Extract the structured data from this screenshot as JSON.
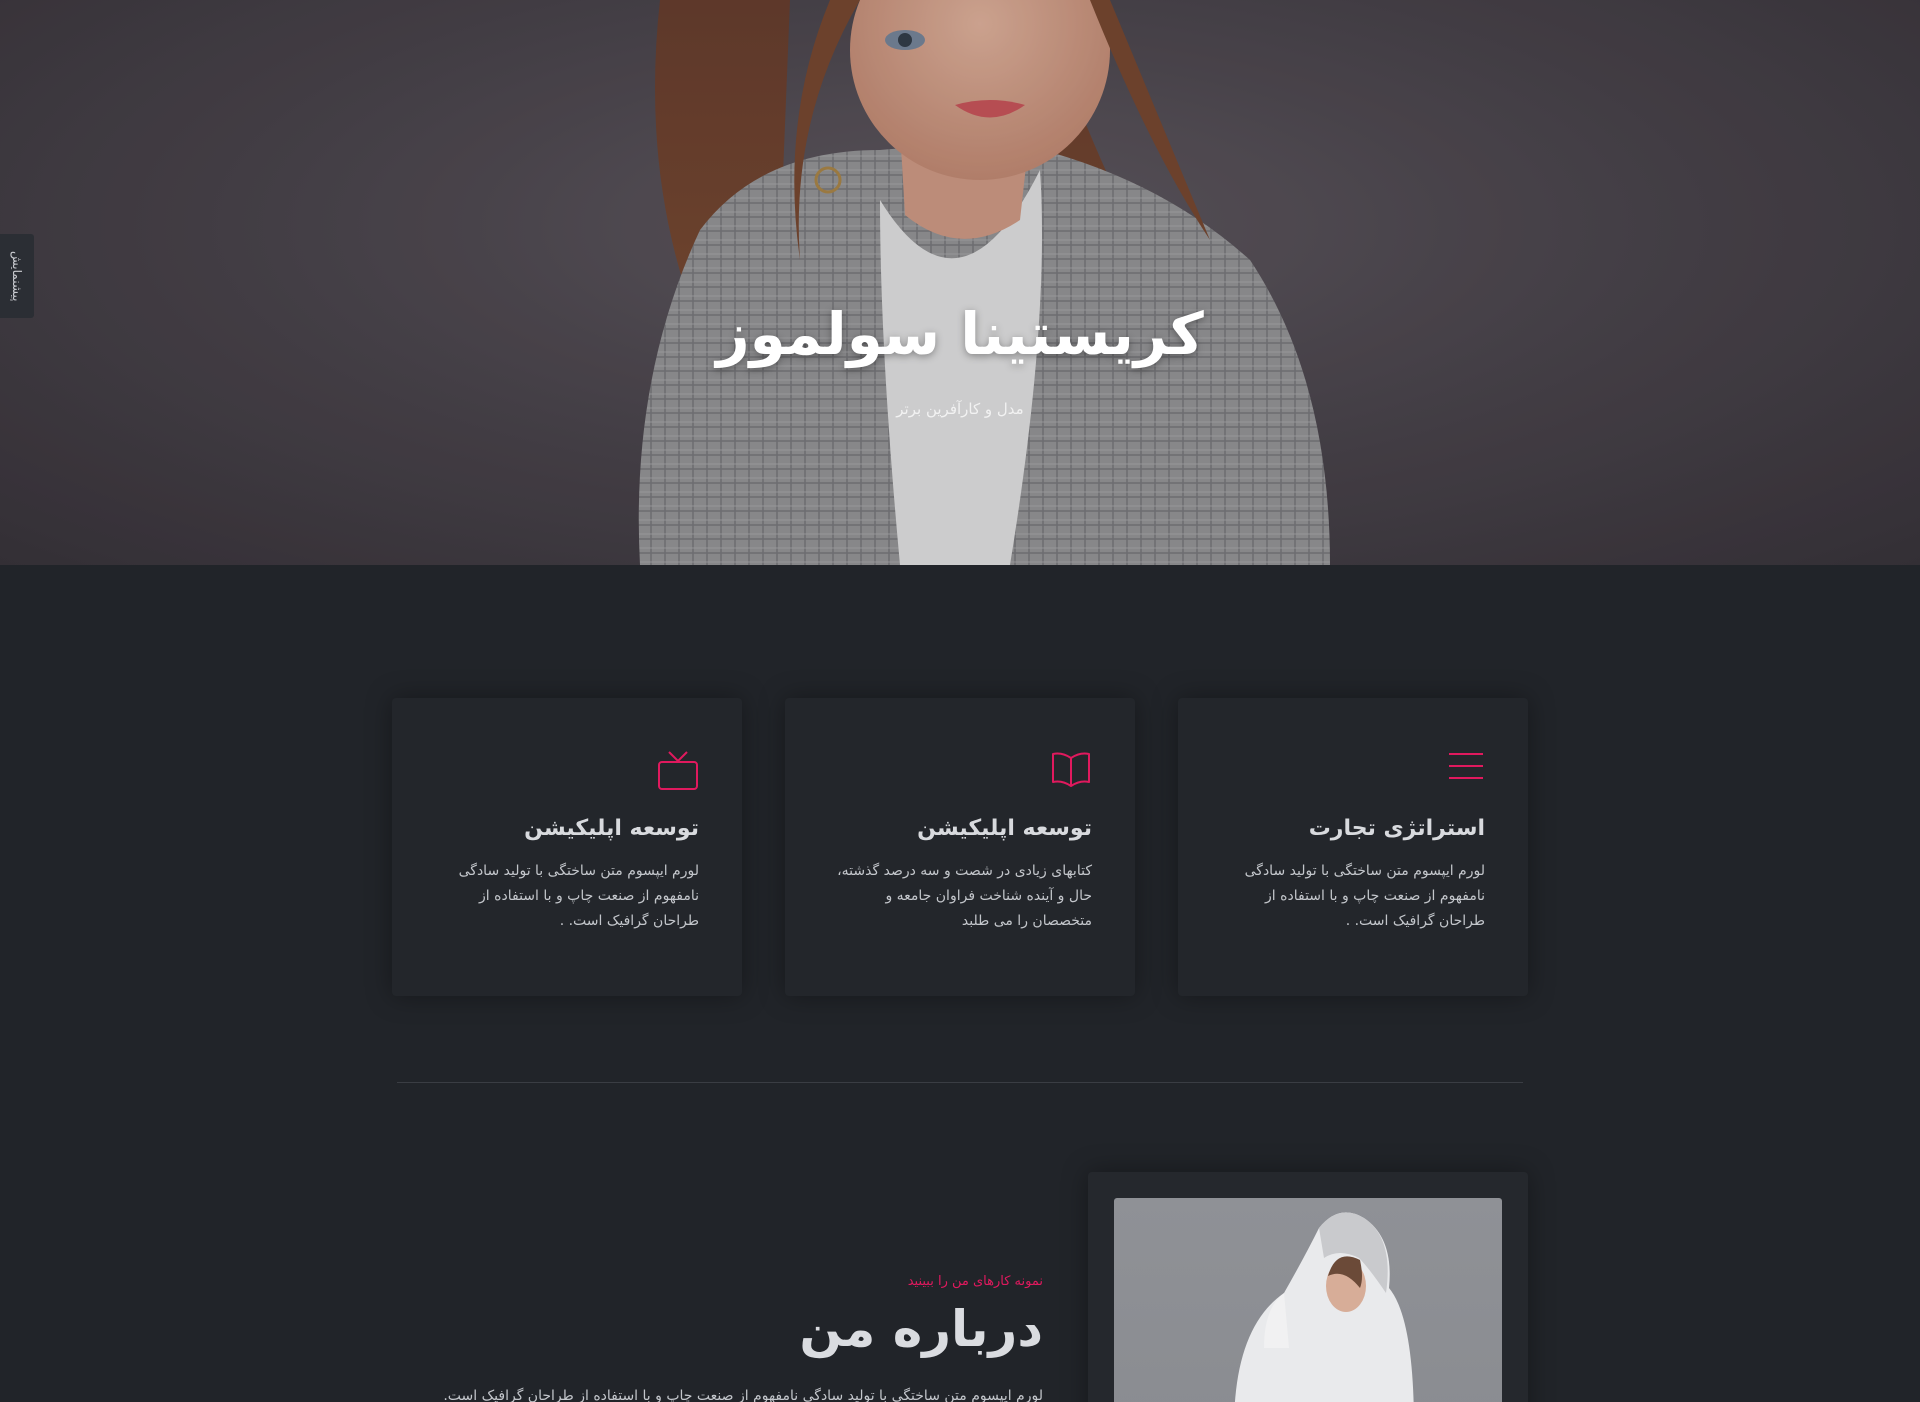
{
  "side_tab": {
    "label": "پیشنمایش"
  },
  "hero": {
    "title": "کریستینا سولموز",
    "subtitle": "مدل و کارآفرین برتر"
  },
  "services": {
    "accent_color": "#e0195e",
    "cards": [
      {
        "icon": "menu-lines-icon",
        "title": "استراتژی تجارت",
        "text": "لورم ایپسوم متن ساختگی با تولید سادگی نامفهوم از صنعت چاپ و با استفاده از طراحان گرافیک است. ."
      },
      {
        "icon": "open-book-icon",
        "title": "توسعه اپلیکیشن",
        "text": "کتابهای زیادی در شصت و سه درصد گذشته، حال و آینده شناخت فراوان جامعه و متخصصان را می طلبد"
      },
      {
        "icon": "tv-icon",
        "title": "توسعه اپلیکیشن",
        "text": "لورم ایپسوم متن ساختگی با تولید سادگی نامفهوم از صنعت چاپ و با استفاده از طراحان گرافیک است. ."
      }
    ]
  },
  "about": {
    "kicker": "نمونه کارهای من را ببینید",
    "title": "درباره من",
    "text": "لورم ایپسوم متن ساختگی با تولید سادگی نامفهوم از صنعت چاپ و با استفاده از طراحان گرافیک است."
  }
}
